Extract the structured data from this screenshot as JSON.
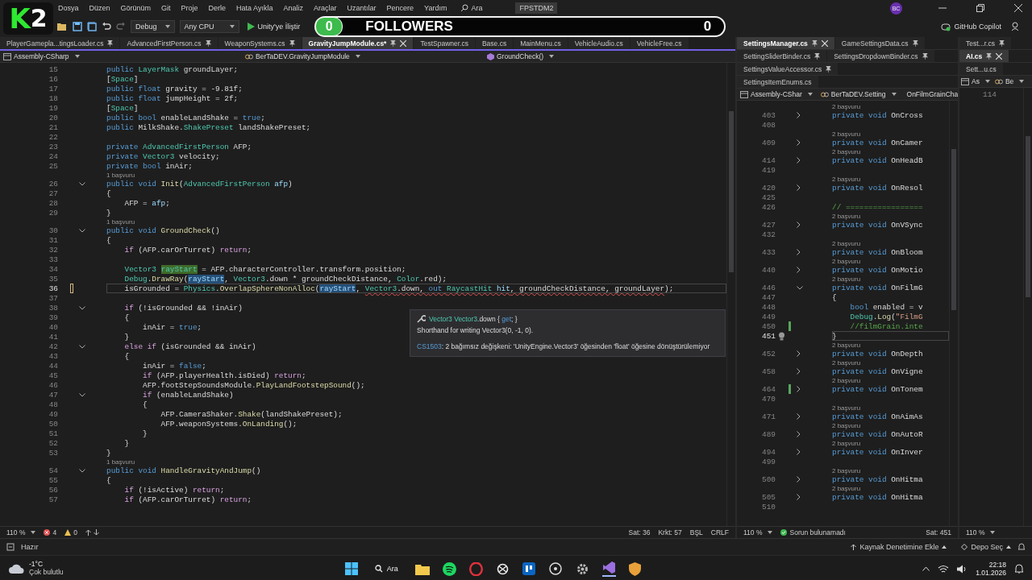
{
  "logo": {
    "letter": "K",
    "number": "2"
  },
  "menu": [
    "Dosya",
    "Düzen",
    "Görünüm",
    "Git",
    "Proje",
    "Derle",
    "Hata Ayıkla",
    "Analiz",
    "Araçlar",
    "Uzantılar",
    "Pencere",
    "Yardım"
  ],
  "search": {
    "placeholder": "Ara"
  },
  "solution": "FPSTDM2",
  "account": {
    "initials": "BC"
  },
  "toolbar": {
    "configuration": "Debug",
    "platform": "Any CPU",
    "attach": "Unity'ye İliştir",
    "copilot": "GitHub Copilot"
  },
  "followers": {
    "left_count": "0",
    "label": "FOLLOWERS",
    "right_count": "0"
  },
  "editors": [
    {
      "tab_rows": [
        [
          {
            "label": "PlayerGamepla...tingsLoader.cs",
            "pinned": true,
            "selected": false
          },
          {
            "label": "AdvancedFirstPerson.cs",
            "pinned": true,
            "selected": false
          },
          {
            "label": "WeaponSystems.cs",
            "pinned": true,
            "selected": false
          },
          {
            "label": "GravityJumpModule.cs*",
            "pinned": true,
            "selected": true
          },
          {
            "label": "TestSpawner.cs",
            "pinned": false,
            "selected": false
          },
          {
            "label": "Base.cs",
            "pinned": false,
            "selected": false
          },
          {
            "label": "MainMenu.cs",
            "pinned": false,
            "selected": false
          },
          {
            "label": "VehicleAudio.cs",
            "pinned": false,
            "selected": false
          },
          {
            "label": "VehicleFree.cs",
            "pinned": false,
            "selected": false
          }
        ]
      ],
      "nav": {
        "project": "Assembly-CSharp",
        "type": "BerTaDEV.GravityJumpModule",
        "member": "GroundCheck()"
      },
      "lines": [
        {
          "n": "15",
          "segs": [
            {
              "kind": "keyword",
              "text": "public "
            },
            {
              "kind": "type",
              "text": "LayerMask"
            },
            {
              "kind": "plain",
              "text": " groundLayer;"
            }
          ]
        },
        {
          "n": "16",
          "segs": [
            {
              "kind": "plain",
              "text": "["
            },
            {
              "kind": "type",
              "text": "Space"
            },
            {
              "kind": "plain",
              "text": "]"
            }
          ]
        },
        {
          "n": "17",
          "segs": [
            {
              "kind": "keyword",
              "text": "public float"
            },
            {
              "kind": "plain",
              "text": " gravity = -9.81f;"
            }
          ]
        },
        {
          "n": "18",
          "segs": [
            {
              "kind": "keyword",
              "text": "public float"
            },
            {
              "kind": "plain",
              "text": " jumpHeight = 2f;"
            }
          ]
        },
        {
          "n": "19",
          "segs": [
            {
              "kind": "plain",
              "text": "["
            },
            {
              "kind": "type",
              "text": "Space"
            },
            {
              "kind": "plain",
              "text": "]"
            }
          ]
        },
        {
          "n": "20",
          "segs": [
            {
              "kind": "keyword",
              "text": "public bool"
            },
            {
              "kind": "plain",
              "text": " enableLandShake = "
            },
            {
              "kind": "keyword",
              "text": "true"
            },
            {
              "kind": "plain",
              "text": ";"
            }
          ]
        },
        {
          "n": "21",
          "segs": [
            {
              "kind": "keyword",
              "text": "public "
            },
            {
              "kind": "plain",
              "text": "MilkShake."
            },
            {
              "kind": "type",
              "text": "ShakePreset"
            },
            {
              "kind": "plain",
              "text": " landShakePreset;"
            }
          ]
        },
        {
          "n": "22"
        },
        {
          "n": "23",
          "segs": [
            {
              "kind": "keyword",
              "text": "private "
            },
            {
              "kind": "type",
              "text": "AdvancedFirstPerson"
            },
            {
              "kind": "plain",
              "text": " AFP;"
            }
          ]
        },
        {
          "n": "24",
          "segs": [
            {
              "kind": "keyword",
              "text": "private "
            },
            {
              "kind": "type",
              "text": "Vector3"
            },
            {
              "kind": "plain",
              "text": " velocity;"
            }
          ]
        },
        {
          "n": "25",
          "segs": [
            {
              "kind": "keyword",
              "text": "private bool"
            },
            {
              "kind": "plain",
              "text": " inAir;"
            }
          ]
        },
        {
          "lens": "1 başvuru"
        },
        {
          "n": "26",
          "expanded": true,
          "segs": [
            {
              "kind": "keyword",
              "text": "public void "
            },
            {
              "kind": "method",
              "text": "Init"
            },
            {
              "kind": "plain",
              "text": "("
            },
            {
              "kind": "type",
              "text": "AdvancedFirstPerson"
            },
            {
              "kind": "param",
              "text": " afp"
            },
            {
              "kind": "plain",
              "text": ")"
            }
          ]
        },
        {
          "n": "27",
          "segs": [
            {
              "kind": "plain",
              "text": "{"
            }
          ]
        },
        {
          "n": "28",
          "segs": [
            {
              "kind": "plain",
              "text": "    AFP = "
            },
            {
              "kind": "param",
              "text": "afp"
            },
            {
              "kind": "plain",
              "text": ";"
            }
          ]
        },
        {
          "n": "29",
          "segs": [
            {
              "kind": "plain",
              "text": "}"
            }
          ]
        },
        {
          "lens": "1 başvuru"
        },
        {
          "n": "30",
          "expanded": true,
          "segs": [
            {
              "kind": "keyword",
              "text": "public void "
            },
            {
              "kind": "method",
              "text": "GroundCheck"
            },
            {
              "kind": "plain",
              "text": "()"
            }
          ]
        },
        {
          "n": "31",
          "segs": [
            {
              "kind": "plain",
              "text": "{"
            }
          ]
        },
        {
          "n": "32",
          "segs": [
            {
              "kind": "control",
              "text": "    if"
            },
            {
              "kind": "plain",
              "text": " (AFP.carOrTurret) "
            },
            {
              "kind": "control",
              "text": "return"
            },
            {
              "kind": "plain",
              "text": ";"
            }
          ]
        },
        {
          "n": "33"
        },
        {
          "n": "34",
          "segs": [
            {
              "kind": "type",
              "text": "    Vector3 "
            },
            {
              "kind": "def_highlight",
              "text": "rayStart"
            },
            {
              "kind": "plain",
              "text": " = AFP.characterController.transform.position;"
            }
          ]
        },
        {
          "n": "35",
          "segs": [
            {
              "kind": "type",
              "text": "    Debug"
            },
            {
              "kind": "plain",
              "text": "."
            },
            {
              "kind": "method",
              "text": "DrawRay"
            },
            {
              "kind": "plain",
              "text": "("
            },
            {
              "kind": "ref_highlight",
              "text": "rayStart"
            },
            {
              "kind": "plain",
              "text": ", "
            },
            {
              "kind": "type",
              "text": "Vector3"
            },
            {
              "kind": "plain",
              "text": ".down * groundCheckDistance, "
            },
            {
              "kind": "type",
              "text": "Color"
            },
            {
              "kind": "plain",
              "text": ".red);"
            }
          ]
        },
        {
          "n": "36",
          "current": true,
          "saved": false,
          "segs": [
            {
              "kind": "plain",
              "text": "    isGrounded = "
            },
            {
              "kind": "type",
              "text": "Physics"
            },
            {
              "kind": "plain",
              "text": "."
            },
            {
              "kind": "method",
              "text": "OverlapSphereNonAlloc"
            },
            {
              "kind": "plain",
              "text": "("
            },
            {
              "kind": "ref_highlight",
              "text": "rayStart"
            },
            {
              "kind": "plain",
              "text": ", "
            },
            {
              "kind": "type",
              "text": "Vector3",
              "squiggle": true
            },
            {
              "kind": "plain",
              "text": ".down, ",
              "squiggle": true
            },
            {
              "kind": "keyword",
              "text": "out ",
              "squiggle": true
            },
            {
              "kind": "type",
              "text": "RaycastHit",
              "squiggle": true
            },
            {
              "kind": "param",
              "text": " hit",
              "squiggle": true
            },
            {
              "kind": "plain",
              "text": ", groundCheckDistance, groundLayer",
              "squiggle": true
            },
            {
              "kind": "plain",
              "text": ");"
            }
          ]
        },
        {
          "n": "37"
        },
        {
          "n": "38",
          "expanded": true,
          "segs": [
            {
              "kind": "control",
              "text": "    if"
            },
            {
              "kind": "plain",
              "text": " (!isGrounded && !inAir)"
            }
          ]
        },
        {
          "n": "39",
          "segs": [
            {
              "kind": "plain",
              "text": "    {"
            }
          ]
        },
        {
          "n": "40",
          "segs": [
            {
              "kind": "plain",
              "text": "        inAir = "
            },
            {
              "kind": "keyword",
              "text": "true"
            },
            {
              "kind": "plain",
              "text": ";"
            }
          ]
        },
        {
          "n": "41",
          "segs": [
            {
              "kind": "plain",
              "text": "    }"
            }
          ]
        },
        {
          "n": "42",
          "expanded": true,
          "segs": [
            {
              "kind": "control",
              "text": "    else if"
            },
            {
              "kind": "plain",
              "text": " (isGrounded && inAir)"
            }
          ]
        },
        {
          "n": "43",
          "segs": [
            {
              "kind": "plain",
              "text": "    {"
            }
          ]
        },
        {
          "n": "44",
          "segs": [
            {
              "kind": "plain",
              "text": "        inAir = "
            },
            {
              "kind": "keyword",
              "text": "false"
            },
            {
              "kind": "plain",
              "text": ";"
            }
          ]
        },
        {
          "n": "45",
          "segs": [
            {
              "kind": "control",
              "text": "        if"
            },
            {
              "kind": "plain",
              "text": " (AFP.playerHealth.isDied) "
            },
            {
              "kind": "control",
              "text": "return"
            },
            {
              "kind": "plain",
              "text": ";"
            }
          ]
        },
        {
          "n": "46",
          "segs": [
            {
              "kind": "plain",
              "text": "        AFP.footStepSoundsModule."
            },
            {
              "kind": "method",
              "text": "PlayLandFootstepSound"
            },
            {
              "kind": "plain",
              "text": "();"
            }
          ]
        },
        {
          "n": "47",
          "expanded": true,
          "segs": [
            {
              "kind": "control",
              "text": "        if"
            },
            {
              "kind": "plain",
              "text": " (enableLandShake)"
            }
          ]
        },
        {
          "n": "48",
          "segs": [
            {
              "kind": "plain",
              "text": "        {"
            }
          ]
        },
        {
          "n": "49",
          "segs": [
            {
              "kind": "plain",
              "text": "            AFP.CameraShaker."
            },
            {
              "kind": "method",
              "text": "Shake"
            },
            {
              "kind": "plain",
              "text": "(landShakePreset);"
            }
          ]
        },
        {
          "n": "50",
          "segs": [
            {
              "kind": "plain",
              "text": "            AFP.weaponSystems."
            },
            {
              "kind": "method",
              "text": "OnLanding"
            },
            {
              "kind": "plain",
              "text": "();"
            }
          ]
        },
        {
          "n": "51",
          "segs": [
            {
              "kind": "plain",
              "text": "        }"
            }
          ]
        },
        {
          "n": "52",
          "segs": [
            {
              "kind": "plain",
              "text": "    }"
            }
          ]
        },
        {
          "n": "53",
          "segs": [
            {
              "kind": "plain",
              "text": "}"
            }
          ]
        },
        {
          "lens": "1 başvuru"
        },
        {
          "n": "54",
          "expanded": true,
          "segs": [
            {
              "kind": "keyword",
              "text": "public void "
            },
            {
              "kind": "method",
              "text": "HandleGravityAndJump"
            },
            {
              "kind": "plain",
              "text": "()"
            }
          ]
        },
        {
          "n": "55",
          "segs": [
            {
              "kind": "plain",
              "text": "{"
            }
          ]
        },
        {
          "n": "56",
          "segs": [
            {
              "kind": "control",
              "text": "    if"
            },
            {
              "kind": "plain",
              "text": " (!isActive) "
            },
            {
              "kind": "control",
              "text": "return"
            },
            {
              "kind": "plain",
              "text": ";"
            }
          ]
        },
        {
          "n": "57",
          "segs": [
            {
              "kind": "control",
              "text": "    if"
            },
            {
              "kind": "plain",
              "text": " (AFP.carOrTurret) "
            },
            {
              "kind": "control",
              "text": "return"
            },
            {
              "kind": "plain",
              "text": ";"
            }
          ]
        }
      ],
      "tooltip": {
        "signature": [
          {
            "kind": "type",
            "text": "Vector3 Vector3"
          },
          {
            "kind": "plain",
            "text": ".down { "
          },
          {
            "kind": "keyword",
            "text": "get"
          },
          {
            "kind": "plain",
            "text": "; }"
          }
        ],
        "summary": "Shorthand for writing Vector3(0, -1, 0).",
        "error_code": "CS1503",
        "error_text": ": 2 bağımsız değişkeni: 'UnityEngine.Vector3' öğesinden 'float' öğesine dönüştürülemiyor"
      },
      "status": {
        "left": [
          {
            "kind": "zoom",
            "text": "110 %"
          },
          {
            "kind": "errors",
            "text": "4"
          },
          {
            "kind": "warnings",
            "text": "0"
          },
          {
            "kind": "arrows"
          }
        ],
        "right": [
          {
            "kind": "text",
            "text": "Sat: 36"
          },
          {
            "kind": "text",
            "text": "Krkt: 57"
          },
          {
            "kind": "text",
            "text": "BŞL"
          },
          {
            "kind": "text",
            "text": "CRLF"
          }
        ]
      }
    },
    {
      "tab_rows": [
        [
          {
            "label": "SettingsManager.cs",
            "pinned": true,
            "selected": true
          },
          {
            "label": "GameSettingsData.cs",
            "pinned": true,
            "selected": false
          }
        ],
        [
          {
            "label": "SettingSliderBinder.cs",
            "pinned": true,
            "selected": false
          },
          {
            "label": "SettingsDropdownBinder.cs",
            "pinned": true,
            "selected": false
          }
        ],
        [
          {
            "label": "SettingsValueAccessor.cs",
            "pinned": true,
            "selected": false
          }
        ],
        [
          {
            "label": "SettingsItemEnums.cs",
            "pinned": false,
            "selected": false
          }
        ]
      ],
      "nav": {
        "project": "Assembly-CShar",
        "type": "BerTaDEV.Setting",
        "member": "OnFilmGrainCha"
      },
      "lines": [
        {
          "lens": "2 başvuru"
        },
        {
          "n": "403",
          "expanded": false,
          "segs": [
            {
              "kind": "keyword",
              "text": "private void "
            },
            {
              "kind": "plain",
              "text": "OnCross"
            }
          ]
        },
        {
          "n": "408"
        },
        {
          "lens": "2 başvuru"
        },
        {
          "n": "409",
          "expanded": false,
          "segs": [
            {
              "kind": "keyword",
              "text": "private void "
            },
            {
              "kind": "plain",
              "text": "OnCamer"
            }
          ]
        },
        {
          "lens": "2 başvuru"
        },
        {
          "n": "414",
          "expanded": false,
          "segs": [
            {
              "kind": "keyword",
              "text": "private void "
            },
            {
              "kind": "plain",
              "text": "OnHeadB"
            }
          ]
        },
        {
          "n": "419"
        },
        {
          "lens": "2 başvuru"
        },
        {
          "n": "420",
          "expanded": false,
          "segs": [
            {
              "kind": "keyword",
              "text": "private void "
            },
            {
              "kind": "plain",
              "text": "OnResol"
            }
          ]
        },
        {
          "n": "425"
        },
        {
          "n": "426",
          "segs": [
            {
              "kind": "comment",
              "text": "// ================="
            }
          ]
        },
        {
          "lens": "2 başvuru"
        },
        {
          "n": "427",
          "expanded": false,
          "segs": [
            {
              "kind": "keyword",
              "text": "private void "
            },
            {
              "kind": "plain",
              "text": "OnVSync"
            }
          ]
        },
        {
          "n": "432"
        },
        {
          "lens": "2 başvuru"
        },
        {
          "n": "433",
          "expanded": false,
          "segs": [
            {
              "kind": "keyword",
              "text": "private void "
            },
            {
              "kind": "plain",
              "text": "OnBloom"
            }
          ]
        },
        {
          "lens": "2 başvuru"
        },
        {
          "n": "440",
          "expanded": false,
          "segs": [
            {
              "kind": "keyword",
              "text": "private void "
            },
            {
              "kind": "plain",
              "text": "OnMotio"
            }
          ]
        },
        {
          "lens": "2 başvuru"
        },
        {
          "n": "446",
          "expanded": true,
          "segs": [
            {
              "kind": "keyword",
              "text": "private void "
            },
            {
              "kind": "plain",
              "text": "OnFilmG"
            }
          ]
        },
        {
          "n": "447",
          "segs": [
            {
              "kind": "plain",
              "text": "{"
            }
          ]
        },
        {
          "n": "448",
          "segs": [
            {
              "kind": "keyword",
              "text": "    bool "
            },
            {
              "kind": "plain",
              "text": "enabled = v"
            }
          ]
        },
        {
          "n": "449",
          "segs": [
            {
              "kind": "type",
              "text": "    Debug"
            },
            {
              "kind": "plain",
              "text": "."
            },
            {
              "kind": "method",
              "text": "Log"
            },
            {
              "kind": "plain",
              "text": "("
            },
            {
              "kind": "string",
              "text": "\"FilmG"
            }
          ]
        },
        {
          "n": "450",
          "saved": true,
          "segs": [
            {
              "kind": "comment",
              "text": "    //filmGrain.inte"
            }
          ]
        },
        {
          "n": "451",
          "current": true,
          "bulb": true,
          "segs": [
            {
              "kind": "plain",
              "text": "}"
            }
          ]
        },
        {
          "lens": "2 başvuru"
        },
        {
          "n": "452",
          "expanded": false,
          "segs": [
            {
              "kind": "keyword",
              "text": "private void "
            },
            {
              "kind": "plain",
              "text": "OnDepth"
            }
          ]
        },
        {
          "lens": "2 başvuru"
        },
        {
          "n": "458",
          "expanded": false,
          "segs": [
            {
              "kind": "keyword",
              "text": "private void "
            },
            {
              "kind": "plain",
              "text": "OnVigne"
            }
          ]
        },
        {
          "lens": "2 başvuru"
        },
        {
          "n": "464",
          "expanded": false,
          "saved": true,
          "segs": [
            {
              "kind": "keyword",
              "text": "private void "
            },
            {
              "kind": "plain",
              "text": "OnTonem"
            }
          ]
        },
        {
          "n": "470"
        },
        {
          "lens": "2 başvuru"
        },
        {
          "n": "471",
          "expanded": false,
          "segs": [
            {
              "kind": "keyword",
              "text": "private void "
            },
            {
              "kind": "plain",
              "text": "OnAimAs"
            }
          ]
        },
        {
          "lens": "2 başvuru"
        },
        {
          "n": "489",
          "expanded": false,
          "segs": [
            {
              "kind": "keyword",
              "text": "private void "
            },
            {
              "kind": "plain",
              "text": "OnAutoR"
            }
          ]
        },
        {
          "lens": "2 başvuru"
        },
        {
          "n": "494",
          "expanded": false,
          "segs": [
            {
              "kind": "keyword",
              "text": "private void "
            },
            {
              "kind": "plain",
              "text": "OnInver"
            }
          ]
        },
        {
          "n": "499"
        },
        {
          "lens": "2 başvuru"
        },
        {
          "n": "500",
          "expanded": false,
          "segs": [
            {
              "kind": "keyword",
              "text": "private void "
            },
            {
              "kind": "plain",
              "text": "OnHitma"
            }
          ]
        },
        {
          "lens": "2 başvuru"
        },
        {
          "n": "505",
          "expanded": false,
          "segs": [
            {
              "kind": "keyword",
              "text": "private void "
            },
            {
              "kind": "plain",
              "text": "OnHitma"
            }
          ]
        },
        {
          "n": "510"
        }
      ],
      "status": {
        "left": [
          {
            "kind": "zoom",
            "text": "110 %"
          },
          {
            "kind": "check",
            "text": "Sorun bulunamadı"
          }
        ],
        "right": [
          {
            "kind": "text",
            "text": "Sat: 451"
          }
        ]
      }
    },
    {
      "tab_rows": [
        [
          {
            "label": "Test...r.cs",
            "pinned": true,
            "selected": false
          }
        ],
        [
          {
            "label": "AI.cs",
            "pinned": true,
            "selected": true
          }
        ],
        [
          {
            "label": "Sett...u.cs",
            "pinned": false,
            "selected": false
          }
        ]
      ],
      "nav": {
        "project": "As",
        "type": "Be"
      },
      "lines": [
        {
          "n": "114"
        }
      ],
      "status": {
        "left": [
          {
            "kind": "zoom",
            "text": "110 %"
          }
        ]
      }
    }
  ],
  "statusbar": {
    "state": "Hazır",
    "source_control": "Kaynak Denetimine Ekle",
    "repository": "Depo Seç"
  },
  "taskbar": {
    "temperature": "-1°C",
    "weather": "Çok bulutlu",
    "search": "Ara",
    "time": "22:18",
    "date": "1.01.2026"
  }
}
